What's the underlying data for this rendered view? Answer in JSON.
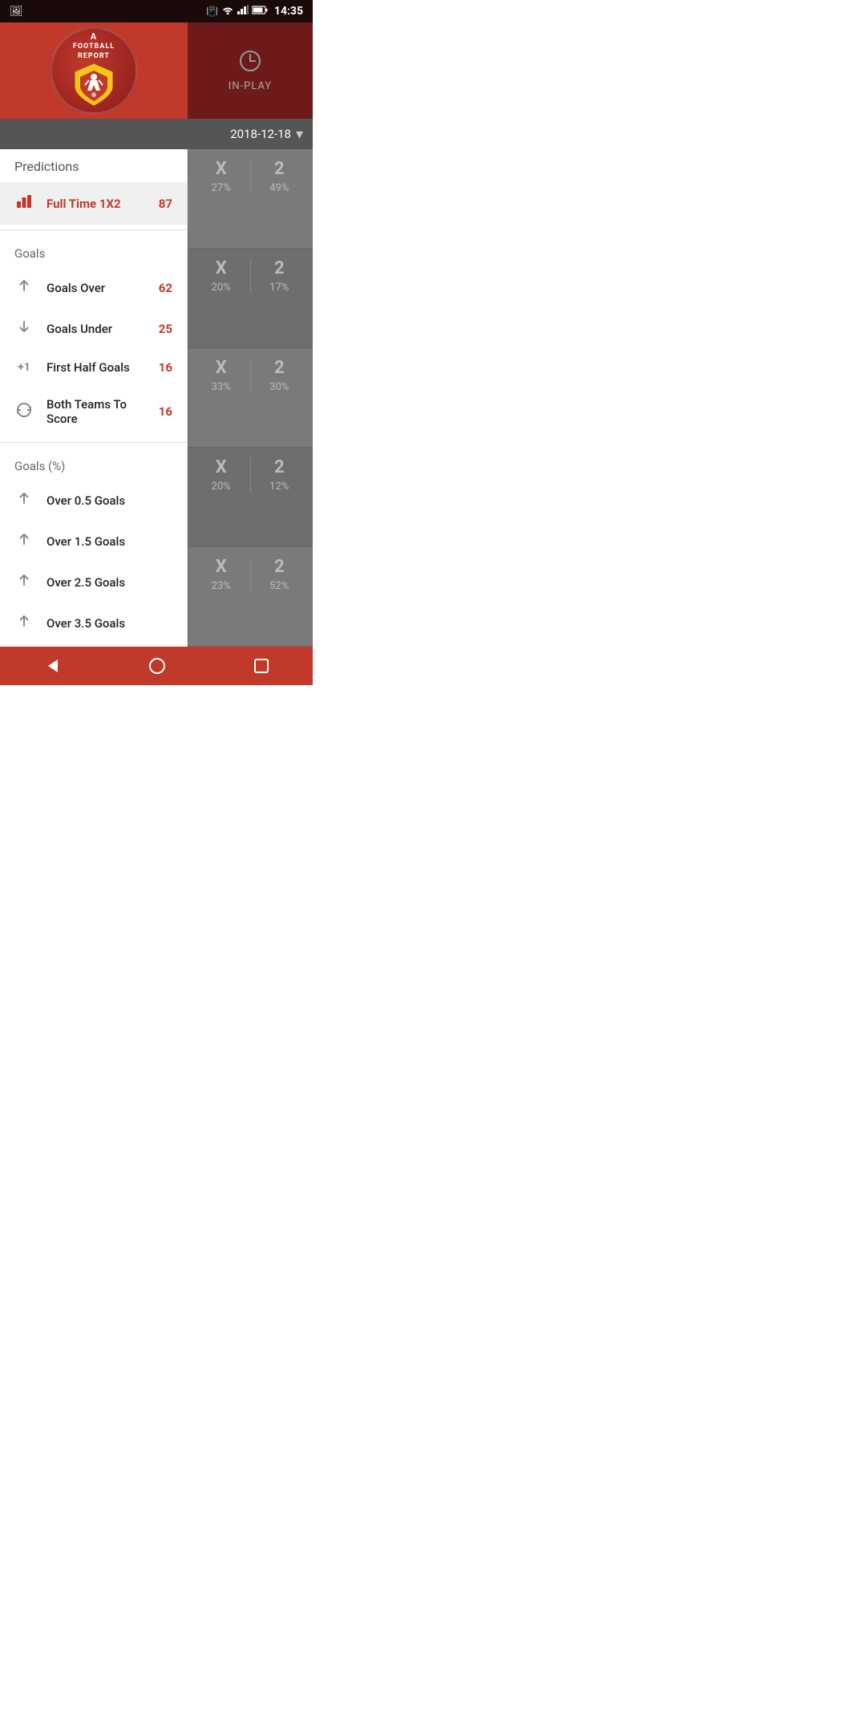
{
  "statusBar": {
    "time": "14:35",
    "icons": [
      "image-icon",
      "vibrate-icon",
      "wifi-icon",
      "signal-icon",
      "battery-icon"
    ]
  },
  "header": {
    "logoLine1": "A",
    "logoLine2": "FOOTBALL",
    "logoLine3": "REPORT",
    "inplayLabel": "IN-PLAY"
  },
  "dateSelector": {
    "date": "2018-12-18"
  },
  "sidebar": {
    "predictionsLabel": "Predictions",
    "menuItems": [
      {
        "id": "full-time-1x2",
        "label": "Full Time 1X2",
        "count": "87",
        "active": true,
        "iconType": "chart"
      },
      {
        "id": "goals-section-label",
        "label": "Goals",
        "isSection": true
      },
      {
        "id": "goals-over",
        "label": "Goals Over",
        "count": "62",
        "iconType": "arrow-up"
      },
      {
        "id": "goals-under",
        "label": "Goals Under",
        "count": "25",
        "iconType": "arrow-down"
      },
      {
        "id": "first-half-goals",
        "label": "First Half Goals",
        "count": "16",
        "iconType": "plus-one"
      },
      {
        "id": "both-teams-score",
        "label": "Both Teams To Score",
        "count": "16",
        "iconType": "refresh"
      },
      {
        "id": "goals-pct-label",
        "label": "Goals (%)",
        "isSection": true
      },
      {
        "id": "over-05",
        "label": "Over 0.5 Goals",
        "iconType": "arrow-up"
      },
      {
        "id": "over-15",
        "label": "Over 1.5 Goals",
        "iconType": "arrow-up"
      },
      {
        "id": "over-25",
        "label": "Over 2.5 Goals",
        "iconType": "arrow-up"
      },
      {
        "id": "over-35",
        "label": "Over 3.5 Goals",
        "iconType": "arrow-up"
      }
    ]
  },
  "matchCards": [
    {
      "cols": [
        {
          "val": "X",
          "pct": "27%"
        },
        {
          "val": "2",
          "pct": "49%"
        }
      ]
    },
    {
      "cols": [
        {
          "val": "X",
          "pct": "20%"
        },
        {
          "val": "2",
          "pct": "17%"
        }
      ]
    },
    {
      "cols": [
        {
          "val": "X",
          "pct": "33%"
        },
        {
          "val": "2",
          "pct": "30%"
        }
      ]
    },
    {
      "cols": [
        {
          "val": "X",
          "pct": "20%"
        },
        {
          "val": "2",
          "pct": "12%"
        }
      ]
    },
    {
      "cols": [
        {
          "val": "X",
          "pct": "23%"
        },
        {
          "val": "2",
          "pct": "52%"
        }
      ]
    }
  ],
  "bottomNav": {
    "items": [
      "back-icon",
      "home-icon",
      "square-icon"
    ]
  }
}
